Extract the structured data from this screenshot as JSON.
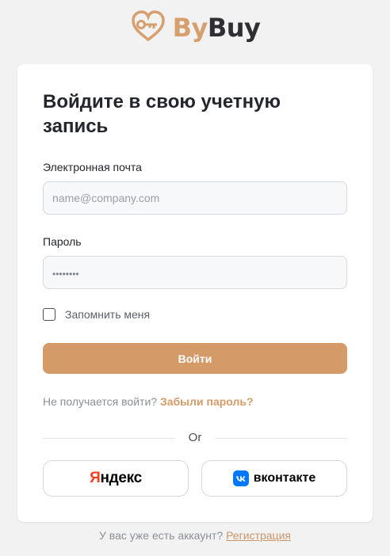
{
  "brand": {
    "name_part1": "By",
    "name_part2": "Buy",
    "logo_icon": "heart-key-icon",
    "accent_color": "#d49b68"
  },
  "login": {
    "title": "Войдите в свою учетную запись",
    "email_label": "Электронная почта",
    "email_placeholder": "name@company.com",
    "password_label": "Пароль",
    "password_value": "••••••••",
    "remember_label": "Запомнить меня",
    "remember_checked": false,
    "submit_label": "Войти",
    "trouble_text": "Не получается войти?",
    "forgot_link": "Забыли пароль?",
    "divider_text": "Or"
  },
  "social": {
    "yandex_first_letter": "Я",
    "yandex_rest": "ндекс",
    "vk_label": "вконтакте",
    "vk_icon": "vk-icon"
  },
  "footer": {
    "question": "У вас уже есть аккаунт?",
    "register_link": "Регистрация"
  }
}
